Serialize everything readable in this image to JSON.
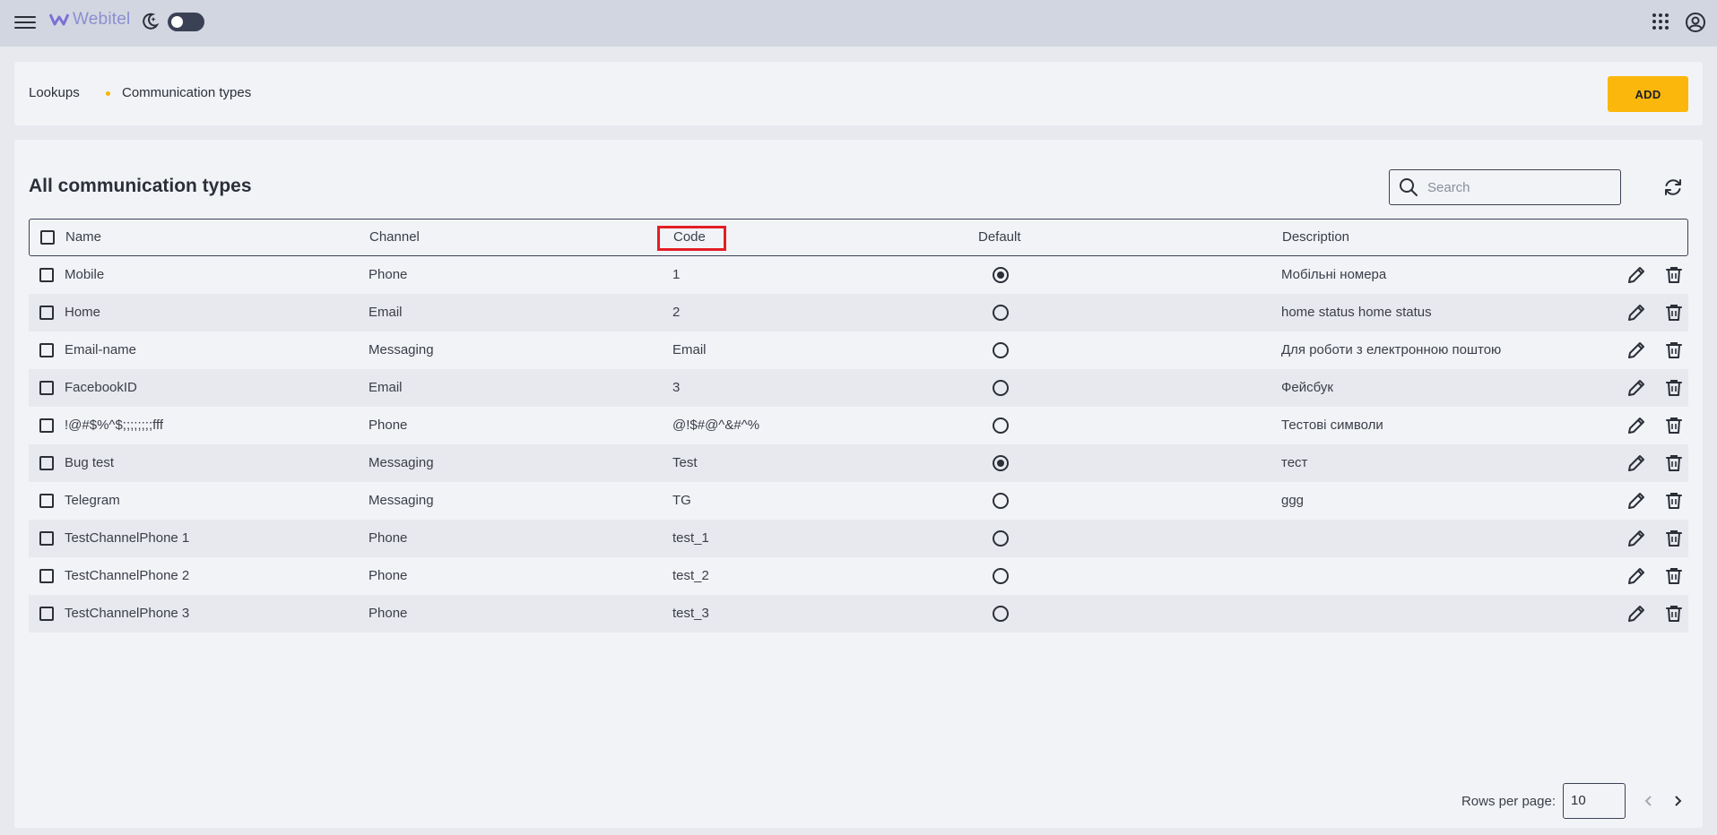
{
  "app": {
    "name": "Webitel"
  },
  "breadcrumb": {
    "root": "Lookups",
    "current": "Communication types"
  },
  "header": {
    "add_label": "ADD"
  },
  "panel": {
    "title": "All communication types"
  },
  "search": {
    "placeholder": "Search",
    "value": ""
  },
  "table": {
    "columns": {
      "name": "Name",
      "channel": "Channel",
      "code": "Code",
      "default": "Default",
      "description": "Description"
    },
    "rows": [
      {
        "name": "Mobile",
        "channel": "Phone",
        "code": "1",
        "default": true,
        "description": "Мобільні номера"
      },
      {
        "name": "Home",
        "channel": "Email",
        "code": "2",
        "default": false,
        "description": "home status home status"
      },
      {
        "name": "Email-name",
        "channel": "Messaging",
        "code": "Email",
        "default": false,
        "description": "Для роботи з електронною поштою"
      },
      {
        "name": "FacebookID",
        "channel": "Email",
        "code": "3",
        "default": false,
        "description": "Фейсбук"
      },
      {
        "name": "!@#$%^$;;;;;;;;fff",
        "channel": "Phone",
        "code": "@!$#@^&#^%",
        "default": false,
        "description": "Тестові символи"
      },
      {
        "name": "Bug test",
        "channel": "Messaging",
        "code": "Test",
        "default": true,
        "description": "тест"
      },
      {
        "name": "Telegram",
        "channel": "Messaging",
        "code": "TG",
        "default": false,
        "description": "ggg"
      },
      {
        "name": "TestChannelPhone 1",
        "channel": "Phone",
        "code": "test_1",
        "default": false,
        "description": ""
      },
      {
        "name": "TestChannelPhone 2",
        "channel": "Phone",
        "code": "test_2",
        "default": false,
        "description": ""
      },
      {
        "name": "TestChannelPhone 3",
        "channel": "Phone",
        "code": "test_3",
        "default": false,
        "description": ""
      }
    ]
  },
  "pagination": {
    "rows_per_page_label": "Rows per page:",
    "rows_per_page": "10"
  },
  "colors": {
    "accent": "#fbb70b",
    "highlight": "#e41e26",
    "topbar": "#d2d6e1"
  },
  "icons": [
    "menu-icon",
    "webitel-logo-icon",
    "moon-icon",
    "apps-grid-icon",
    "account-icon",
    "search-icon",
    "refresh-icon",
    "edit-pencil-icon",
    "trash-icon",
    "chevron-left-icon",
    "chevron-right-icon"
  ]
}
